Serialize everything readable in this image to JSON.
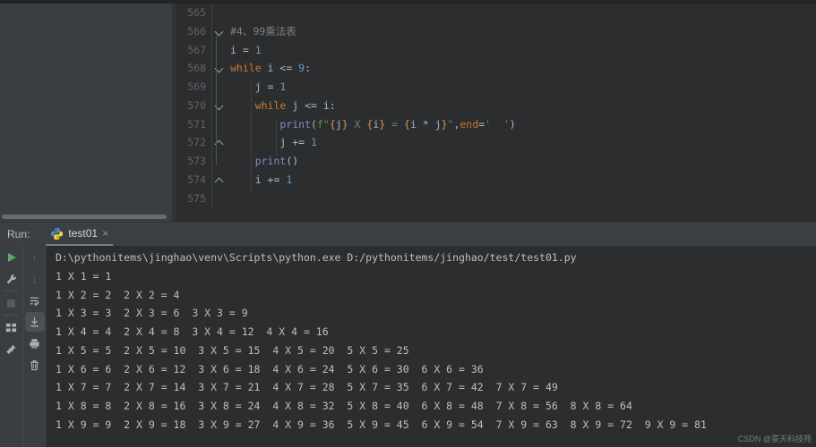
{
  "run_panel": {
    "label": "Run:",
    "tab": {
      "title": "test01",
      "close": "×"
    },
    "toolbar_left_icons": [
      "rerun",
      "settings",
      "stop",
      "restore-layout",
      "pin"
    ],
    "toolbar_right_icons": [
      "up-stack-trace",
      "down-stack-trace",
      "soft-wrap",
      "scroll-to-end",
      "print",
      "clear-all"
    ],
    "arrows": {
      "up": "↑",
      "down": "↓"
    }
  },
  "editor": {
    "lines": [
      {
        "num": "565",
        "tokens": []
      },
      {
        "num": "566",
        "fold": "open",
        "tokens": [
          [
            "#4、99乘法表",
            "comment"
          ]
        ]
      },
      {
        "num": "567",
        "tokens": [
          [
            "i = ",
            "text"
          ],
          [
            "1",
            "number"
          ]
        ]
      },
      {
        "num": "568",
        "fold": "open",
        "tokens": [
          [
            "while",
            "keyword"
          ],
          [
            " i <= ",
            "text"
          ],
          [
            "9",
            "number"
          ],
          [
            ":",
            "text"
          ]
        ]
      },
      {
        "num": "569",
        "tokens": [
          [
            "    j = ",
            "text"
          ],
          [
            "1",
            "number"
          ]
        ]
      },
      {
        "num": "570",
        "fold": "open",
        "tokens": [
          [
            "    ",
            "text"
          ],
          [
            "while",
            "keyword"
          ],
          [
            " j <= i:",
            "text"
          ]
        ]
      },
      {
        "num": "571",
        "tokens": [
          [
            "        ",
            "text"
          ],
          [
            "print",
            "builtin"
          ],
          [
            "(",
            "text"
          ],
          [
            "f\"",
            "string"
          ],
          [
            "{",
            "brace"
          ],
          [
            "j",
            "text"
          ],
          [
            "}",
            "brace"
          ],
          [
            " X ",
            "string"
          ],
          [
            "{",
            "brace"
          ],
          [
            "i",
            "text"
          ],
          [
            "}",
            "brace"
          ],
          [
            " = ",
            "string"
          ],
          [
            "{",
            "brace"
          ],
          [
            "i * j",
            "text"
          ],
          [
            "}",
            "brace"
          ],
          [
            "\"",
            "string"
          ],
          [
            ",",
            "text"
          ],
          [
            "end",
            "keyword"
          ],
          [
            "=",
            "text"
          ],
          [
            "'  '",
            "string"
          ],
          [
            ")",
            "text"
          ]
        ]
      },
      {
        "num": "572",
        "fold": "end",
        "tokens": [
          [
            "        j += ",
            "text"
          ],
          [
            "1",
            "number"
          ]
        ]
      },
      {
        "num": "573",
        "tokens": [
          [
            "    ",
            "text"
          ],
          [
            "print",
            "builtin"
          ],
          [
            "()",
            "text"
          ]
        ]
      },
      {
        "num": "574",
        "fold": "end",
        "tokens": [
          [
            "    i += ",
            "text"
          ],
          [
            "1",
            "number"
          ]
        ]
      },
      {
        "num": "575",
        "tokens": []
      }
    ]
  },
  "console": {
    "lines": [
      "D:\\pythonitems\\jinghao\\venv\\Scripts\\python.exe D:/pythonitems/jinghao/test/test01.py",
      "1 X 1 = 1",
      "1 X 2 = 2  2 X 2 = 4",
      "1 X 3 = 3  2 X 3 = 6  3 X 3 = 9",
      "1 X 4 = 4  2 X 4 = 8  3 X 4 = 12  4 X 4 = 16",
      "1 X 5 = 5  2 X 5 = 10  3 X 5 = 15  4 X 5 = 20  5 X 5 = 25",
      "1 X 6 = 6  2 X 6 = 12  3 X 6 = 18  4 X 6 = 24  5 X 6 = 30  6 X 6 = 36",
      "1 X 7 = 7  2 X 7 = 14  3 X 7 = 21  4 X 7 = 28  5 X 7 = 35  6 X 7 = 42  7 X 7 = 49",
      "1 X 8 = 8  2 X 8 = 16  3 X 8 = 24  4 X 8 = 32  5 X 8 = 40  6 X 8 = 48  7 X 8 = 56  8 X 8 = 64",
      "1 X 9 = 9  2 X 9 = 18  3 X 9 = 27  4 X 9 = 36  5 X 9 = 45  6 X 9 = 54  7 X 9 = 63  8 X 9 = 72  9 X 9 = 81"
    ]
  },
  "watermark": "CSDN @景天科技苑",
  "colors": {
    "editor_bg": "#2b2d2f",
    "panel_bg": "#3b3e40",
    "keyword": "#cc7832",
    "number": "#6897bb",
    "string": "#6a8759",
    "builtin": "#8888c6",
    "comment": "#808080",
    "line_number": "#606366",
    "console_text": "#bdbfc1",
    "run_green": "#59a869",
    "python_blue": "#4b8bbe",
    "python_yellow": "#ffd43b"
  }
}
